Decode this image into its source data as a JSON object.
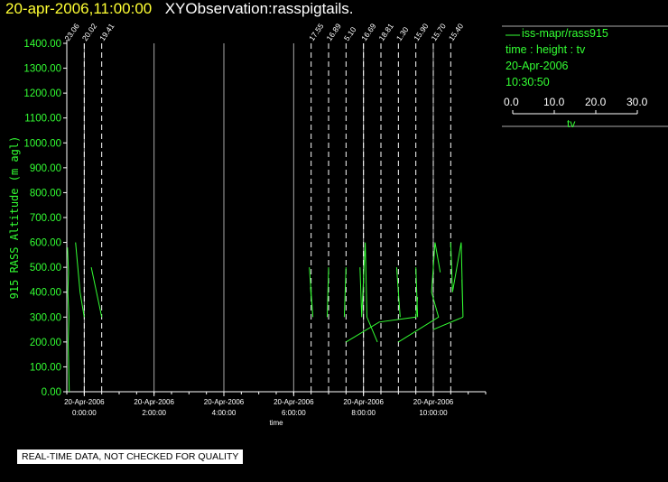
{
  "header": {
    "datetime": "20-apr-2006,11:00:00",
    "title": "XYObservation:rasspigtails."
  },
  "legend": {
    "series": "iss-mapr/rass915",
    "variables": "time : height : tv",
    "date": "20-Apr-2006",
    "time": "10:30:50",
    "scale_ticks": [
      "0.0",
      "10.0",
      "20.0",
      "30.0"
    ],
    "scale_label": "tv"
  },
  "notice": "REAL-TIME DATA, NOT CHECKED FOR QUALITY",
  "colors": {
    "background": "#000000",
    "data": "#33ff33",
    "grid": "#aaaaaa",
    "markers": "#ffffff",
    "title_date": "#ffff33"
  },
  "chart_data": {
    "type": "line",
    "xlabel": "time",
    "ylabel": "915 RASS Altitude (m agl)",
    "xlim": [
      -0.5,
      11.5
    ],
    "ylim": [
      0,
      1400
    ],
    "yticks": [
      "0.00",
      "100.00",
      "200.00",
      "300.00",
      "400.00",
      "500.00",
      "600.00",
      "700.00",
      "800.00",
      "900.00",
      "1000.00",
      "1100.00",
      "1200.00",
      "1300.00",
      "1400.00"
    ],
    "xticks": [
      {
        "x": 0,
        "date": "20-Apr-2006",
        "time": "0:00:00"
      },
      {
        "x": 2,
        "date": "20-Apr-2006",
        "time": "2:00:00"
      },
      {
        "x": 4,
        "date": "20-Apr-2006",
        "time": "4:00:00"
      },
      {
        "x": 6,
        "date": "20-Apr-2006",
        "time": "6:00:00"
      },
      {
        "x": 8,
        "date": "20-Apr-2006",
        "time": "8:00:00"
      },
      {
        "x": 10,
        "date": "20-Apr-2006",
        "time": "10:00:00"
      }
    ],
    "markers": [
      {
        "x": -0.5,
        "label": "23.06"
      },
      {
        "x": 0.0,
        "label": "20.02"
      },
      {
        "x": 0.5,
        "label": "19.41"
      },
      {
        "x": 6.5,
        "label": "17.55"
      },
      {
        "x": 7.0,
        "label": "16.89"
      },
      {
        "x": 7.5,
        "label": "5.10"
      },
      {
        "x": 8.0,
        "label": "16.69"
      },
      {
        "x": 8.5,
        "label": "18.81"
      },
      {
        "x": 9.0,
        "label": "1.30"
      },
      {
        "x": 9.5,
        "label": "15.90"
      },
      {
        "x": 10.0,
        "label": "15.70"
      },
      {
        "x": 10.5,
        "label": "15.40"
      }
    ],
    "series": [
      {
        "values": [
          [
            -0.48,
            580
          ],
          [
            -0.45,
            480
          ],
          [
            -0.47,
            400
          ],
          [
            -0.44,
            300
          ],
          [
            -0.46,
            200
          ],
          [
            -0.43,
            0
          ]
        ]
      },
      {
        "values": [
          [
            -0.25,
            600
          ],
          [
            -0.12,
            400
          ],
          [
            0.0,
            300
          ]
        ]
      },
      {
        "values": [
          [
            0.2,
            500
          ],
          [
            0.35,
            400
          ],
          [
            0.5,
            300
          ]
        ]
      },
      {
        "values": [
          [
            6.45,
            500
          ],
          [
            6.55,
            300
          ],
          [
            6.48,
            420
          ]
        ]
      },
      {
        "values": [
          [
            7.0,
            500
          ],
          [
            6.96,
            300
          ]
        ]
      },
      {
        "values": [
          [
            7.5,
            500
          ],
          [
            7.45,
            300
          ]
        ]
      },
      {
        "values": [
          [
            7.5,
            200
          ],
          [
            8.45,
            280
          ],
          [
            9.5,
            300
          ],
          [
            9.55,
            380
          ]
        ]
      },
      {
        "values": [
          [
            7.9,
            500
          ],
          [
            7.95,
            300
          ],
          [
            8.05,
            600
          ],
          [
            8.1,
            300
          ],
          [
            8.4,
            200
          ]
        ]
      },
      {
        "values": [
          [
            8.95,
            500
          ],
          [
            9.05,
            300
          ]
        ]
      },
      {
        "values": [
          [
            9.5,
            500
          ],
          [
            9.55,
            300
          ]
        ]
      },
      {
        "values": [
          [
            9.0,
            200
          ],
          [
            10.15,
            300
          ],
          [
            9.95,
            400
          ],
          [
            10.05,
            600
          ],
          [
            10.2,
            480
          ]
        ]
      },
      {
        "values": [
          [
            10.5,
            600
          ],
          [
            10.55,
            400
          ],
          [
            10.8,
            600
          ],
          [
            10.85,
            300
          ],
          [
            10.82,
            450
          ]
        ]
      },
      {
        "values": [
          [
            10.0,
            250
          ],
          [
            10.85,
            300
          ]
        ]
      }
    ]
  }
}
